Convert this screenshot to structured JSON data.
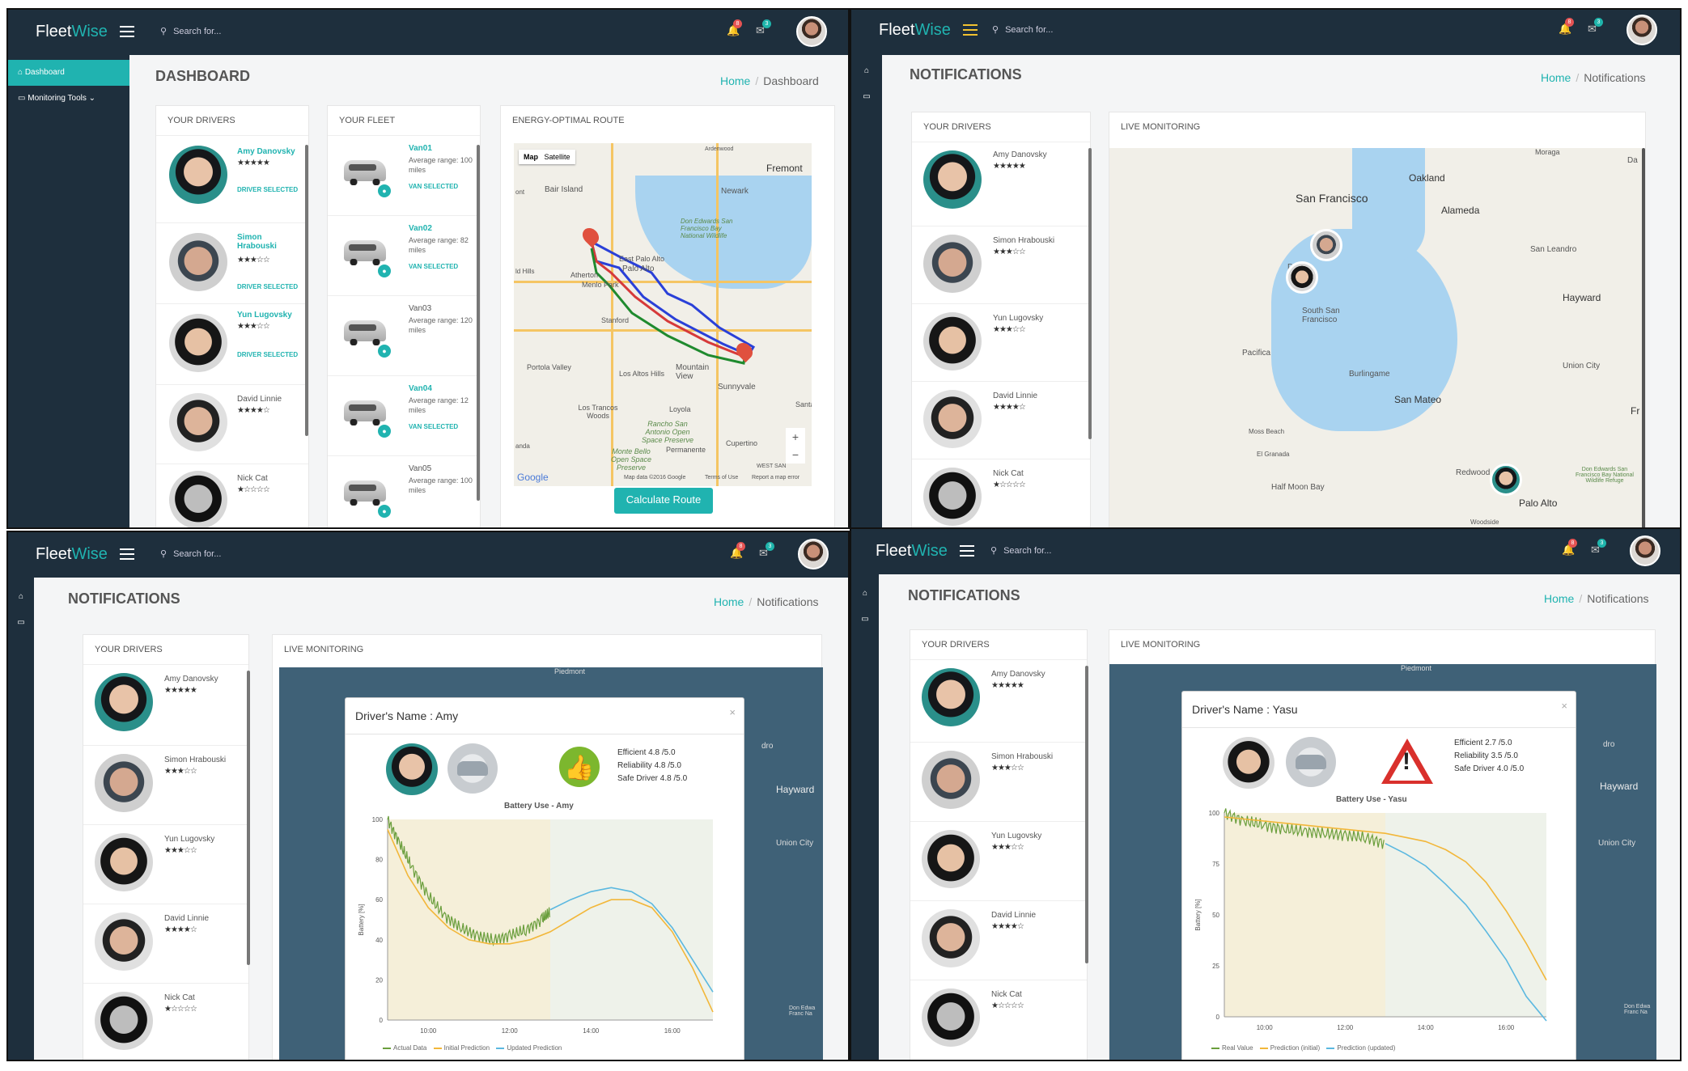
{
  "app": {
    "logo_a": "Fleet",
    "logo_b": "Wise",
    "search_placeholder": "Search for...",
    "bell_count": "8",
    "mail_count": "3"
  },
  "sidebar": {
    "dashboard": "Dashboard",
    "monitoring": "Monitoring Tools"
  },
  "breadcrumb": {
    "home": "Home",
    "dashboard": "Dashboard",
    "notifications": "Notifications"
  },
  "titles": {
    "dashboard": "DASHBOARD",
    "notifications": "NOTIFICATIONS"
  },
  "panels": {
    "drivers": "YOUR DRIVERS",
    "fleet": "YOUR FLEET",
    "route": "ENERGY-OPTIMAL ROUTE",
    "live": "LIVE MONITORING"
  },
  "drivers": [
    {
      "name": "Amy Danovsky",
      "stars": "★★★★★",
      "selected": "DRIVER SELECTED"
    },
    {
      "name": "Simon Hrabouski",
      "stars": "★★★☆☆",
      "selected": "DRIVER SELECTED"
    },
    {
      "name": "Yun Lugovsky",
      "stars": "★★★☆☆",
      "selected": "DRIVER SELECTED"
    },
    {
      "name": "David Linnie",
      "stars": "★★★★☆"
    },
    {
      "name": "Nick Cat",
      "stars": "★☆☆☆☆"
    }
  ],
  "vans": [
    {
      "name": "Van01",
      "range": "Average range: 100 miles",
      "selected": "VAN SELECTED"
    },
    {
      "name": "Van02",
      "range": "Average range: 82 miles",
      "selected": "VAN SELECTED"
    },
    {
      "name": "Van03",
      "range": "Average range: 120 miles"
    },
    {
      "name": "Van04",
      "range": "Average range: 12 miles",
      "selected": "VAN SELECTED"
    },
    {
      "name": "Van05",
      "range": "Average range: 100 miles"
    }
  ],
  "route_map": {
    "tab_map": "Map",
    "tab_satellite": "Satellite",
    "labels": [
      "Fremont",
      "Newark",
      "Bair Island",
      "East Palo Alto",
      "Don Edwards San Francisco Bay National Wildlife",
      "Menlo Park",
      "Atherton",
      "Stanford",
      "Portola Valley",
      "Los Altos Hills",
      "Mountain View",
      "Sunnyvale",
      "Los Trancos Woods",
      "Loyola",
      "Rancho San Antonio Open Space Preserve",
      "Monte Bello Open Space Preserve",
      "Permanente",
      "Cupertino",
      "Palo Alto",
      "Ardenwood",
      "Santa",
      "Google",
      "Map data ©2016 Google",
      "Terms of Use",
      "Report a map error",
      "ld Hills",
      "ont",
      "anda",
      "WEST SAN"
    ],
    "button": "Calculate Route"
  },
  "live_map": {
    "labels": [
      "Oakland",
      "San Francisco",
      "Alameda",
      "San Leandro",
      "Hayward",
      "South San Francisco",
      "Pacifica",
      "Burlingame",
      "Union City",
      "San Mateo",
      "Moss Beach",
      "El Granada",
      "Half Moon Bay",
      "Redwood City",
      "Palo Alto",
      "Woodside",
      "Moraga",
      "Don Edwards San Francisco Bay National Wildlife Refuge",
      "Da",
      "Fr",
      "Da"
    ]
  },
  "modal_amy": {
    "title": "Driver's Name : Amy",
    "efficient": "Efficient 4.8 /5.0",
    "reliability": "Reliability 4.8 /5.0",
    "safe": "Safe Driver 4.8 /5.0",
    "chart_title": "Battery Use - Amy",
    "ylabel": "Battery [%]",
    "legend": [
      "Actual Data",
      "Initial Prediction",
      "Updated Prediction"
    ],
    "close": "×"
  },
  "modal_yasu": {
    "title": "Driver's Name : Yasu",
    "efficient": "Efficient 2.7 /5.0",
    "reliability": "Reliability 3.5 /5.0",
    "safe": "Safe Driver 4.0 /5.0",
    "chart_title": "Battery Use - Yasu",
    "ylabel": "Battery [%]",
    "legend": [
      "Real Value",
      "Prediction (initial)",
      "Prediction (updated)"
    ],
    "close": "×"
  },
  "bg_map_labels": [
    "Piedmont",
    "dro",
    "Hayward",
    "Union City",
    "Don Edwa Franc Na",
    "Don Edwa Franc Na"
  ],
  "colors": {
    "accent": "#20b3b0",
    "topbar": "#1e2f3d",
    "actual": "#6a9e3c",
    "initial": "#f2b73a",
    "updated": "#5bb8e0"
  },
  "chart_data": [
    {
      "type": "line",
      "title": "Battery Use - Amy",
      "ylabel": "Battery [%]",
      "xlabel": "",
      "x_ticks": [
        "10:00",
        "12:00",
        "14:00",
        "16:00"
      ],
      "y_ticks": [
        0,
        20,
        40,
        60,
        80,
        100
      ],
      "ylim": [
        0,
        100
      ],
      "xlim": [
        9.0,
        17.0
      ],
      "series": [
        {
          "name": "Actual Data",
          "x": [
            9.0,
            9.3,
            9.6,
            10.0,
            10.4,
            10.8,
            11.2,
            11.6,
            12.0,
            12.4,
            12.8,
            13.0
          ],
          "y": [
            100,
            88,
            76,
            62,
            52,
            46,
            42,
            40,
            42,
            45,
            50,
            54
          ]
        },
        {
          "name": "Initial Prediction",
          "x": [
            9.0,
            9.5,
            10.0,
            10.5,
            11.0,
            11.5,
            12.0,
            12.5,
            13.0,
            13.5,
            14.0,
            14.5,
            15.0,
            15.5,
            16.0,
            16.5,
            17.0
          ],
          "y": [
            95,
            72,
            56,
            46,
            40,
            38,
            38,
            40,
            44,
            50,
            56,
            60,
            60,
            56,
            44,
            26,
            4
          ]
        },
        {
          "name": "Updated Prediction",
          "x": [
            13.0,
            13.5,
            14.0,
            14.5,
            15.0,
            15.5,
            16.0,
            16.5,
            17.0
          ],
          "y": [
            55,
            60,
            64,
            66,
            64,
            58,
            46,
            30,
            14
          ]
        }
      ]
    },
    {
      "type": "line",
      "title": "Battery Use - Yasu",
      "ylabel": "Battery [%]",
      "xlabel": "",
      "x_ticks": [
        "10:00",
        "12:00",
        "14:00",
        "16:00"
      ],
      "y_ticks": [
        0,
        25,
        50,
        75,
        100
      ],
      "ylim": [
        0,
        100
      ],
      "xlim": [
        9.0,
        17.0
      ],
      "series": [
        {
          "name": "Real Value",
          "x": [
            9.0,
            9.5,
            10.0,
            10.5,
            11.0,
            11.5,
            12.0,
            12.5,
            13.0
          ],
          "y": [
            100,
            96,
            94,
            92,
            91,
            90,
            89,
            88,
            85
          ]
        },
        {
          "name": "Prediction (initial)",
          "x": [
            9.0,
            10.0,
            11.0,
            12.0,
            13.0,
            13.5,
            14.0,
            14.5,
            15.0,
            15.5,
            16.0,
            16.5,
            17.0
          ],
          "y": [
            98,
            96,
            94,
            92,
            90,
            88,
            86,
            82,
            76,
            66,
            52,
            36,
            18
          ]
        },
        {
          "name": "Prediction (updated)",
          "x": [
            13.0,
            13.5,
            14.0,
            14.5,
            15.0,
            15.5,
            16.0,
            16.5,
            17.0
          ],
          "y": [
            85,
            80,
            74,
            65,
            55,
            42,
            28,
            10,
            -10
          ]
        }
      ]
    }
  ]
}
